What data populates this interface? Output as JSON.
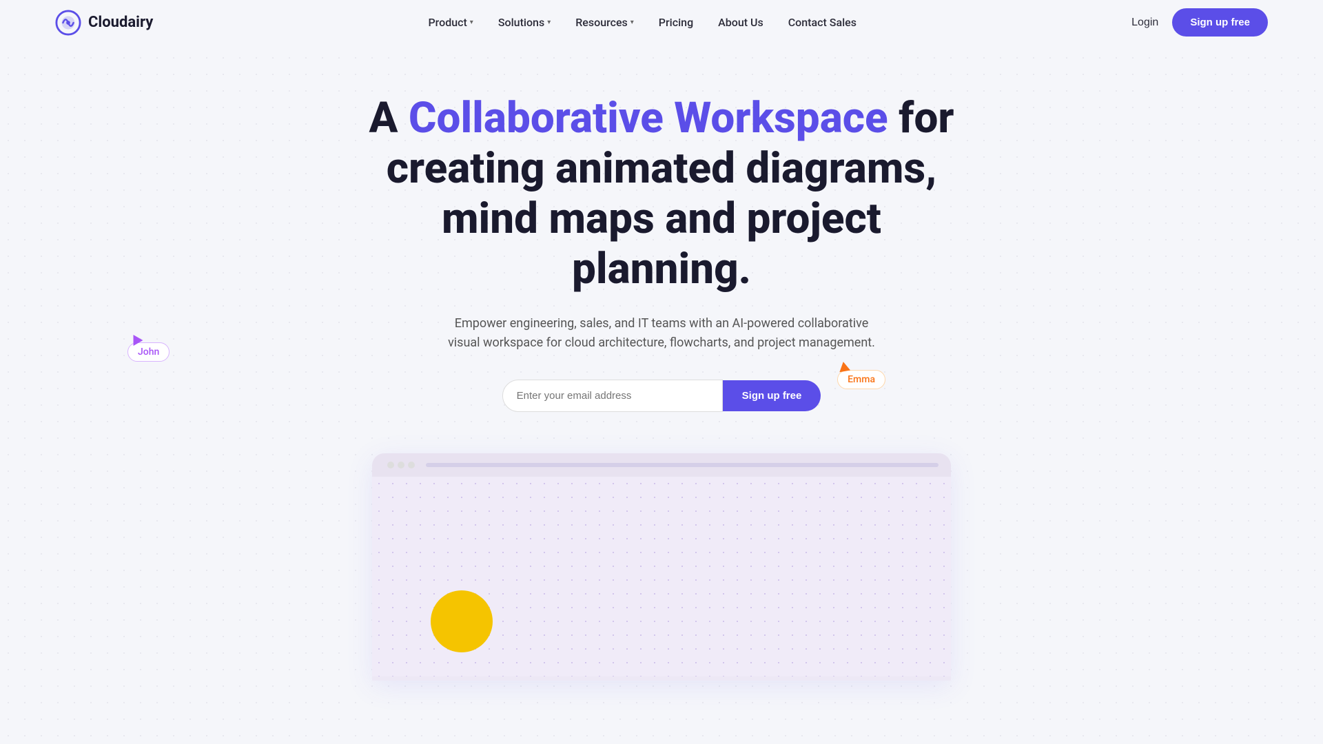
{
  "brand": {
    "name": "Cloudairy",
    "logo_alt": "Cloudairy logo"
  },
  "nav": {
    "links": [
      {
        "label": "Product",
        "has_dropdown": true
      },
      {
        "label": "Solutions",
        "has_dropdown": true
      },
      {
        "label": "Resources",
        "has_dropdown": true
      },
      {
        "label": "Pricing",
        "has_dropdown": false
      },
      {
        "label": "About Us",
        "has_dropdown": false
      },
      {
        "label": "Contact Sales",
        "has_dropdown": false
      }
    ],
    "login_label": "Login",
    "signup_label": "Sign up free"
  },
  "hero": {
    "headline_prefix": "A ",
    "headline_highlight": "Collaborative Workspace",
    "headline_suffix": " for creating animated diagrams, mind maps and project planning.",
    "subtext": "Empower engineering, sales, and IT teams with an AI-powered collaborative visual workspace for cloud architecture, flowcharts, and project management.",
    "email_placeholder": "Enter your email address",
    "signup_button": "Sign up free"
  },
  "cursors": {
    "john": {
      "label": "John",
      "color": "#a855f7",
      "arrow_color": "#a855f7"
    },
    "emma": {
      "label": "Emma",
      "color": "#f97316",
      "arrow_color": "#f97316"
    }
  },
  "app_preview": {
    "titlebar_dots": [
      "dot1",
      "dot2",
      "dot3"
    ]
  },
  "colors": {
    "primary": "#5b4ee8",
    "accent_purple": "#a855f7",
    "accent_orange": "#f97316",
    "yellow_circle": "#f5c400",
    "background": "#f5f6fa"
  }
}
